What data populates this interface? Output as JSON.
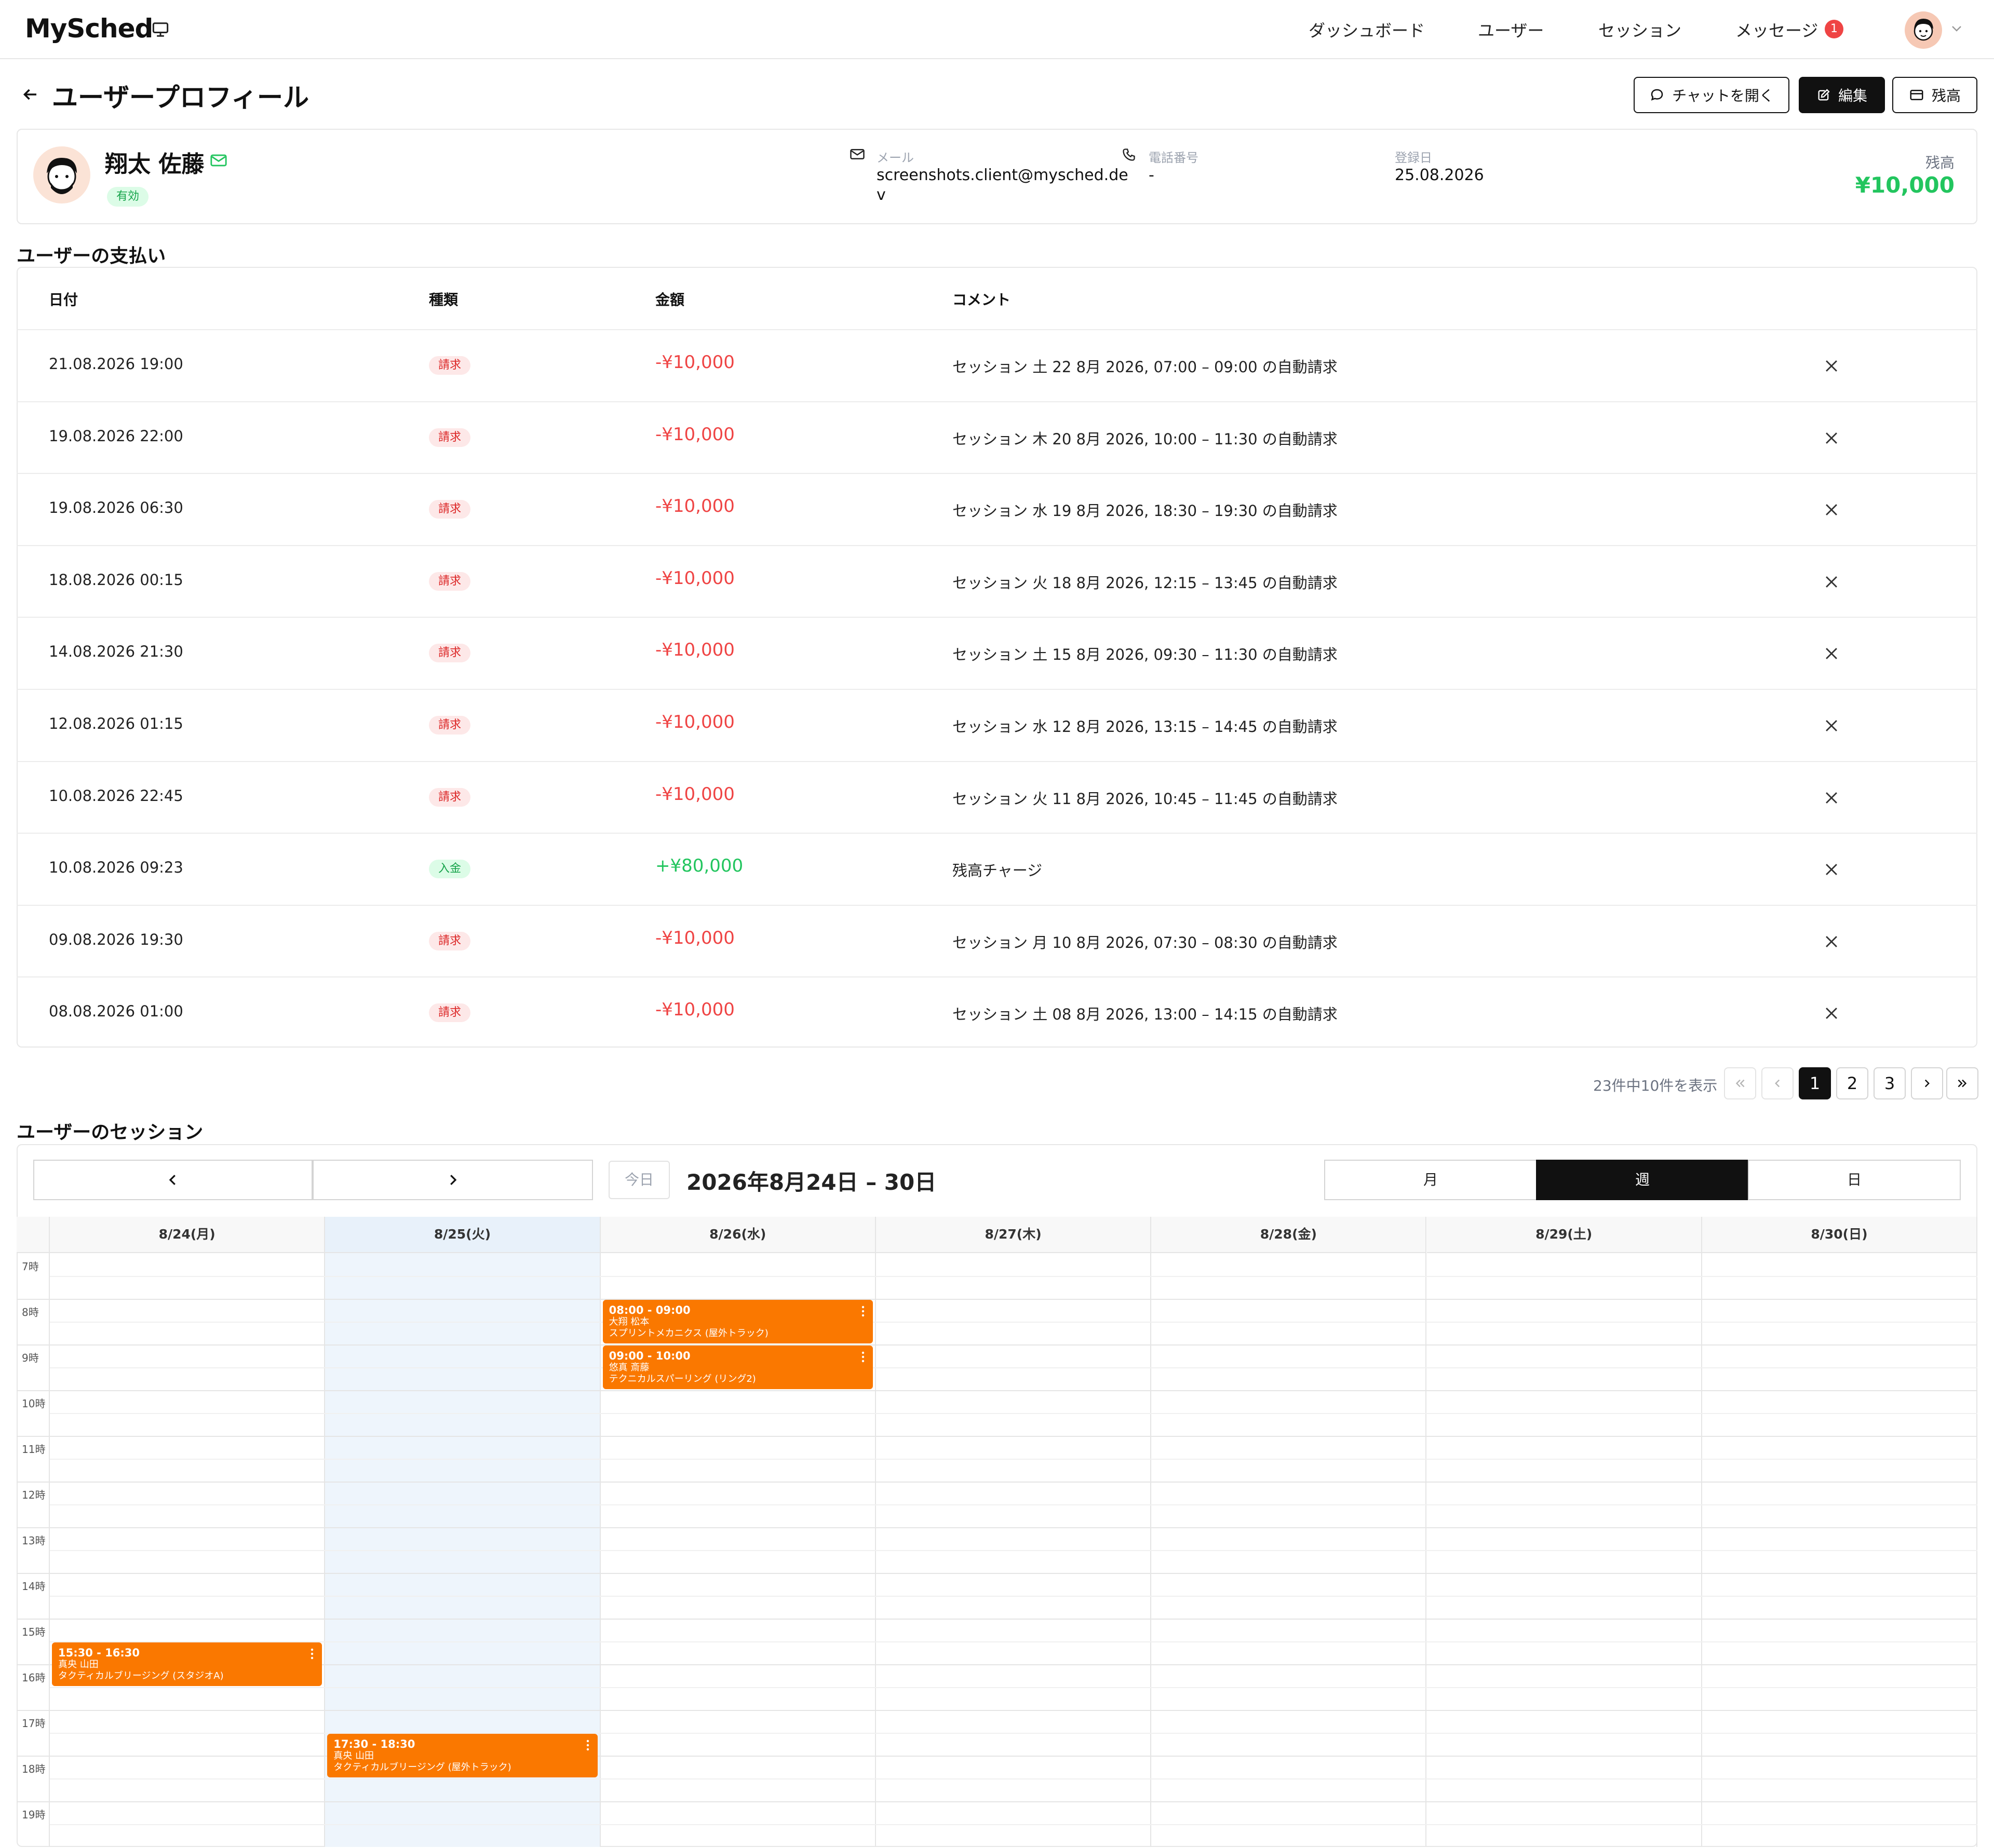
{
  "header": {
    "brand": "MySched",
    "nav": [
      "ダッシュボード",
      "ユーザー",
      "セッション",
      "メッセージ"
    ],
    "message_count": "1"
  },
  "page": {
    "title": "ユーザープロフィール",
    "actions": {
      "chat": "チャットを開く",
      "edit": "編集",
      "balance": "残高"
    }
  },
  "profile": {
    "name": "翔太 佐藤",
    "status": "有効",
    "email_label": "メール",
    "email_line1": "screenshots.client@mysched.de",
    "email_line2": "v",
    "phone_label": "電話番号",
    "phone": "-",
    "registered_label": "登録日",
    "registered": "25.08.2026",
    "balance_label": "残高",
    "balance": "¥10,000"
  },
  "payments": {
    "title": "ユーザーの支払い",
    "columns": [
      "日付",
      "種類",
      "金額",
      "コメント"
    ],
    "rows": [
      {
        "date": "21.08.2026 19:00",
        "type": "請求",
        "amount": "-¥10,000",
        "comment": "セッション 土 22 8月 2026, 07:00 – 09:00 の自動請求"
      },
      {
        "date": "19.08.2026 22:00",
        "type": "請求",
        "amount": "-¥10,000",
        "comment": "セッション 木 20 8月 2026, 10:00 – 11:30 の自動請求"
      },
      {
        "date": "19.08.2026 06:30",
        "type": "請求",
        "amount": "-¥10,000",
        "comment": "セッション 水 19 8月 2026, 18:30 – 19:30 の自動請求"
      },
      {
        "date": "18.08.2026 00:15",
        "type": "請求",
        "amount": "-¥10,000",
        "comment": "セッション 火 18 8月 2026, 12:15 – 13:45 の自動請求"
      },
      {
        "date": "14.08.2026 21:30",
        "type": "請求",
        "amount": "-¥10,000",
        "comment": "セッション 土 15 8月 2026, 09:30 – 11:30 の自動請求"
      },
      {
        "date": "12.08.2026 01:15",
        "type": "請求",
        "amount": "-¥10,000",
        "comment": "セッション 水 12 8月 2026, 13:15 – 14:45 の自動請求"
      },
      {
        "date": "10.08.2026 22:45",
        "type": "請求",
        "amount": "-¥10,000",
        "comment": "セッション 火 11 8月 2026, 10:45 – 11:45 の自動請求"
      },
      {
        "date": "10.08.2026 09:23",
        "type": "入金",
        "amount": "+¥80,000",
        "comment": "残高チャージ"
      },
      {
        "date": "09.08.2026 19:30",
        "type": "請求",
        "amount": "-¥10,000",
        "comment": "セッション 月 10 8月 2026, 07:30 – 08:30 の自動請求"
      },
      {
        "date": "08.08.2026 01:00",
        "type": "請求",
        "amount": "-¥10,000",
        "comment": "セッション 土 08 8月 2026, 13:00 – 14:15 の自動請求"
      }
    ],
    "pagination": {
      "info": "23件中10件を表示",
      "pages": [
        "1",
        "2",
        "3"
      ],
      "current": "1"
    }
  },
  "sessions": {
    "title": "ユーザーのセッション",
    "today": "今日",
    "range": "2026年8月24日 – 30日",
    "views": [
      "月",
      "週",
      "日"
    ],
    "active_view": "週",
    "days": [
      "8/24(月)",
      "8/25(火)",
      "8/26(水)",
      "8/27(木)",
      "8/28(金)",
      "8/29(土)",
      "8/30(日)"
    ],
    "highlight_day": 1,
    "hours": [
      "7時",
      "8時",
      "9時",
      "10時",
      "11時",
      "12時",
      "13時",
      "14時",
      "15時",
      "16時",
      "17時",
      "18時",
      "19時"
    ],
    "events": [
      {
        "day": 0,
        "start": 15.5,
        "end": 16.5,
        "time": "15:30 - 16:30",
        "person": "真央 山田",
        "title": "タクティカルブリージング (スタジオA)"
      },
      {
        "day": 1,
        "start": 17.5,
        "end": 18.5,
        "time": "17:30 - 18:30",
        "person": "真央 山田",
        "title": "タクティカルブリージング (屋外トラック)"
      },
      {
        "day": 2,
        "start": 8.0,
        "end": 9.0,
        "time": "08:00 - 09:00",
        "person": "大翔 松本",
        "title": "スプリントメカニクス (屋外トラック)"
      },
      {
        "day": 2,
        "start": 9.0,
        "end": 10.0,
        "time": "09:00 - 10:00",
        "person": "悠真 斎藤",
        "title": "テクニカルスパーリング (リング2)"
      }
    ],
    "colors": {
      "event": "#fa7800",
      "highlight": "#eef5fc"
    }
  }
}
